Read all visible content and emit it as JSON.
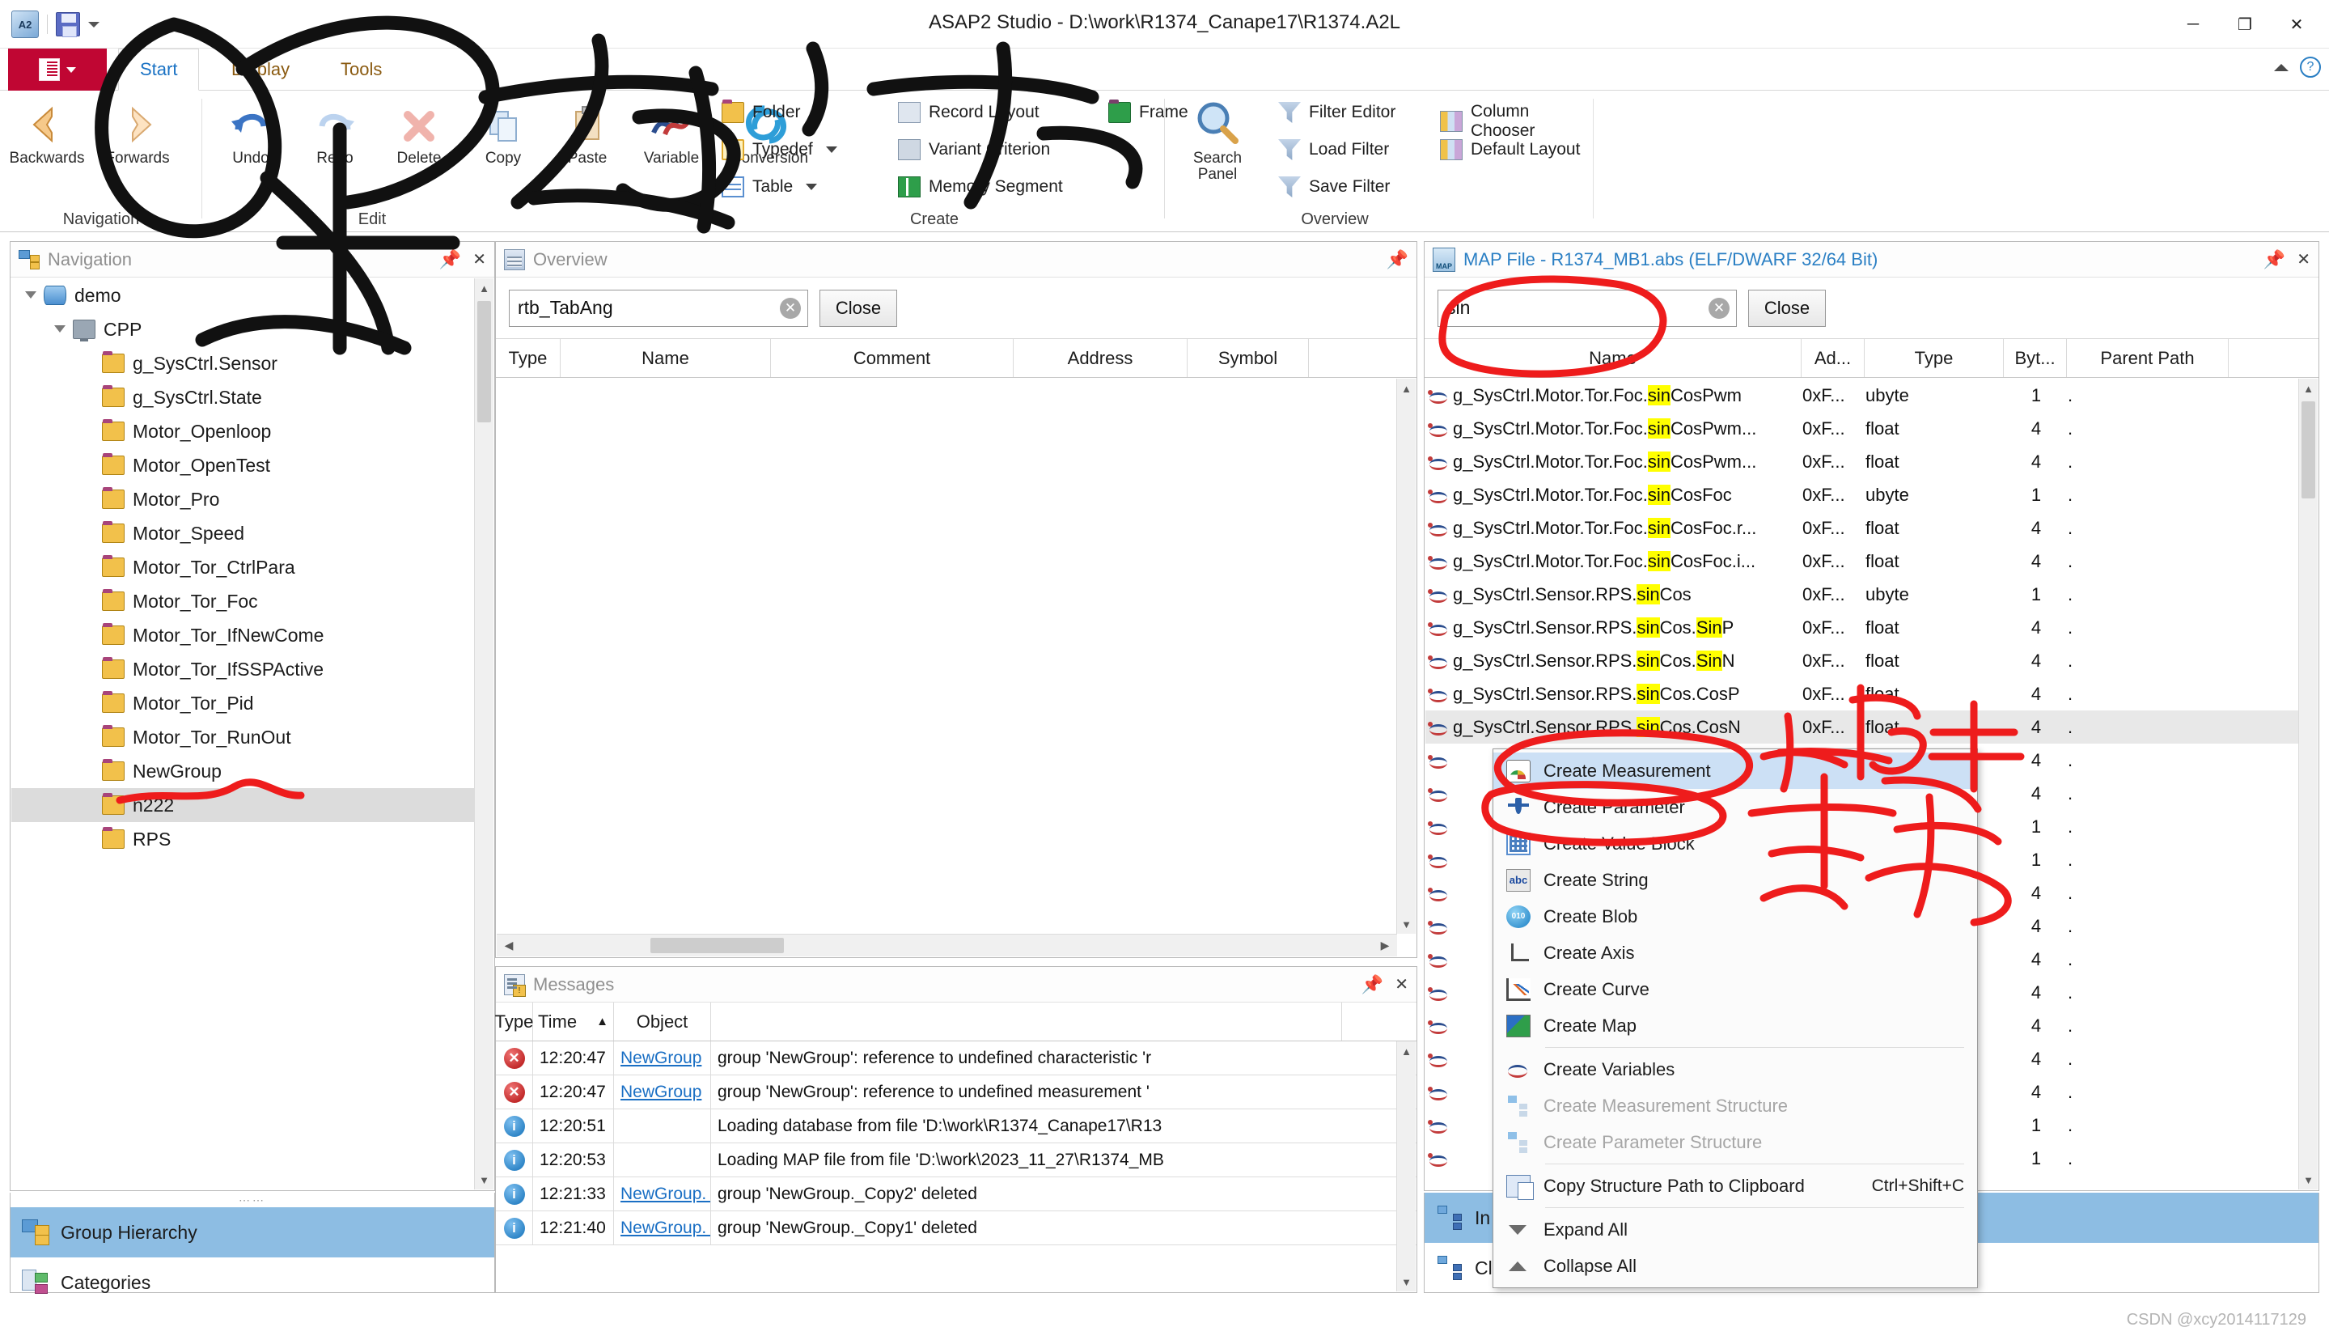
{
  "window": {
    "title": "ASAP2 Studio - D:\\work\\R1374_Canape17\\R1374.A2L",
    "minimize": "─",
    "maximize": "❐",
    "close": "✕"
  },
  "quick_access": {
    "app_icon": "asap2-icon",
    "save_icon": "save-icon",
    "more_icon": "chevron-down-icon"
  },
  "ribbon": {
    "file_label": "",
    "tabs": [
      {
        "label": "Start",
        "active": true
      },
      {
        "label": "Display",
        "active": false
      },
      {
        "label": "Tools",
        "active": false
      }
    ],
    "collapse_icon": "chevron-up-icon",
    "help_icon": "help-icon",
    "groups": [
      {
        "name": "Navigation",
        "buttons": [
          {
            "label": "Backwards",
            "icon": "arrow-left-icon"
          },
          {
            "label": "Forwards",
            "icon": "arrow-right-icon"
          }
        ]
      },
      {
        "name": "Edit",
        "buttons": [
          {
            "label": "Undo",
            "icon": "undo-icon"
          },
          {
            "label": "Redo",
            "icon": "redo-icon"
          },
          {
            "label": "Delete",
            "icon": "delete-icon"
          },
          {
            "label": "Copy",
            "icon": "copy-icon"
          },
          {
            "label": "Paste",
            "icon": "paste-icon"
          },
          {
            "label": "Variable",
            "icon": "variable-icon"
          },
          {
            "label": "Conversion",
            "icon": "conversion-icon"
          }
        ]
      },
      {
        "name": "Create",
        "items": [
          {
            "label": "Folder",
            "icon": "folder-icon",
            "dropdown": true
          },
          {
            "label": "Record Layout",
            "icon": "record-layout-icon",
            "dropdown": false
          },
          {
            "label": "Frame",
            "icon": "frame-icon",
            "dropdown": false
          },
          {
            "label": "Typedef",
            "icon": "typedef-icon",
            "dropdown": true
          },
          {
            "label": "Variant Criterion",
            "icon": "variant-criterion-icon",
            "dropdown": false
          },
          {
            "label": "Table",
            "icon": "table-icon",
            "dropdown": true
          },
          {
            "label": "Memory Segment",
            "icon": "memory-segment-icon",
            "dropdown": false
          }
        ]
      },
      {
        "name": "Overview",
        "big": {
          "label_line1": "Search",
          "label_line2": "Panel",
          "icon": "search-icon"
        },
        "items": [
          {
            "label": "Filter Editor",
            "icon": "filter-editor-icon"
          },
          {
            "label": "Column Chooser",
            "icon": "column-chooser-icon"
          },
          {
            "label": "Load Filter",
            "icon": "load-filter-icon"
          },
          {
            "label": "Default Layout",
            "icon": "default-layout-icon"
          },
          {
            "label": "Save Filter",
            "icon": "save-filter-icon"
          }
        ]
      }
    ]
  },
  "navigation": {
    "title": "Navigation",
    "icon": "navigation-icon",
    "pin_icon": "pin-icon",
    "close_icon": "close-icon",
    "tree": [
      {
        "label": "demo",
        "depth": 0,
        "icon": "database-icon",
        "expander": "open",
        "selected": false
      },
      {
        "label": "CPP",
        "depth": 1,
        "icon": "computer-icon",
        "expander": "open",
        "selected": false
      },
      {
        "label": "g_SysCtrl.Sensor",
        "depth": 2,
        "icon": "folder-icon",
        "expander": "none",
        "selected": false
      },
      {
        "label": "g_SysCtrl.State",
        "depth": 2,
        "icon": "folder-icon",
        "expander": "none",
        "selected": false
      },
      {
        "label": "Motor_Openloop",
        "depth": 2,
        "icon": "folder-icon",
        "expander": "none",
        "selected": false
      },
      {
        "label": "Motor_OpenTest",
        "depth": 2,
        "icon": "folder-icon",
        "expander": "none",
        "selected": false
      },
      {
        "label": "Motor_Pro",
        "depth": 2,
        "icon": "folder-icon",
        "expander": "none",
        "selected": false
      },
      {
        "label": "Motor_Speed",
        "depth": 2,
        "icon": "folder-icon",
        "expander": "none",
        "selected": false
      },
      {
        "label": "Motor_Tor_CtrlPara",
        "depth": 2,
        "icon": "folder-icon",
        "expander": "none",
        "selected": false
      },
      {
        "label": "Motor_Tor_Foc",
        "depth": 2,
        "icon": "folder-icon",
        "expander": "none",
        "selected": false
      },
      {
        "label": "Motor_Tor_IfNewCome",
        "depth": 2,
        "icon": "folder-icon",
        "expander": "none",
        "selected": false
      },
      {
        "label": "Motor_Tor_IfSSPActive",
        "depth": 2,
        "icon": "folder-icon",
        "expander": "none",
        "selected": false
      },
      {
        "label": "Motor_Tor_Pid",
        "depth": 2,
        "icon": "folder-icon",
        "expander": "none",
        "selected": false
      },
      {
        "label": "Motor_Tor_RunOut",
        "depth": 2,
        "icon": "folder-icon",
        "expander": "none",
        "selected": false
      },
      {
        "label": "NewGroup",
        "depth": 2,
        "icon": "folder-icon",
        "expander": "none",
        "selected": false
      },
      {
        "label": "n222",
        "depth": 2,
        "icon": "folder-icon",
        "expander": "none",
        "selected": true
      },
      {
        "label": "RPS",
        "depth": 2,
        "icon": "folder-icon",
        "expander": "none",
        "selected": false
      }
    ],
    "footer_items": [
      {
        "label": "Group Hierarchy",
        "icon": "group-hierarchy-icon",
        "selected": true
      },
      {
        "label": "Categories",
        "icon": "categories-icon",
        "selected": false
      }
    ]
  },
  "overview": {
    "title": "Overview",
    "icon": "overview-icon",
    "pin_icon": "pin-icon",
    "search": {
      "value": "rtb_TabAng",
      "placeholder": "",
      "clear_icon": "clear-icon"
    },
    "close_button": "Close",
    "columns": [
      "Type",
      "Name",
      "Comment",
      "Address",
      "Symbol"
    ],
    "rows": []
  },
  "messages": {
    "title": "Messages",
    "icon": "messages-icon",
    "pin_icon": "pin-icon",
    "close_icon": "close-icon",
    "columns": [
      "Type",
      "Time",
      "Object",
      ""
    ],
    "sort_indicator": "▲",
    "rows": [
      {
        "type": "error",
        "time": "12:20:47",
        "object": "NewGroup",
        "text": "group 'NewGroup': reference to undefined characteristic 'r"
      },
      {
        "type": "error",
        "time": "12:20:47",
        "object": "NewGroup",
        "text": "group 'NewGroup': reference to undefined measurement '"
      },
      {
        "type": "info",
        "time": "12:20:51",
        "object": "",
        "text": "Loading database from file 'D:\\work\\R1374_Canape17\\R13"
      },
      {
        "type": "info",
        "time": "12:20:53",
        "object": "",
        "text": "Loading MAP file from file 'D:\\work\\2023_11_27\\R1374_MB"
      },
      {
        "type": "info",
        "time": "12:21:33",
        "object": "NewGroup._Copy",
        "text": "group 'NewGroup._Copy2' deleted"
      },
      {
        "type": "info",
        "time": "12:21:40",
        "object": "NewGroup._Copy",
        "text": "group 'NewGroup._Copy1' deleted"
      }
    ]
  },
  "map_file": {
    "title": "MAP File - R1374_MB1.abs (ELF/DWARF 32/64 Bit)",
    "icon": "map-file-icon",
    "pin_icon": "pin-icon",
    "close_icon": "close-icon",
    "search": {
      "value": "sin",
      "placeholder": "",
      "clear_icon": "clear-icon"
    },
    "close_button": "Close",
    "columns": [
      "Name",
      "Ad...",
      "Type",
      "Byt...",
      "Parent Path"
    ],
    "highlight_term": "sin",
    "rows": [
      {
        "name": "g_SysCtrl.Motor.Tor.Foc.sinCosPwm",
        "address": "0xF...",
        "type": "ubyte",
        "bytes": "1",
        "parent": "."
      },
      {
        "name": "g_SysCtrl.Motor.Tor.Foc.sinCosPwm...",
        "address": "0xF...",
        "type": "float",
        "bytes": "4",
        "parent": "."
      },
      {
        "name": "g_SysCtrl.Motor.Tor.Foc.sinCosPwm...",
        "address": "0xF...",
        "type": "float",
        "bytes": "4",
        "parent": "."
      },
      {
        "name": "g_SysCtrl.Motor.Tor.Foc.sinCosFoc",
        "address": "0xF...",
        "type": "ubyte",
        "bytes": "1",
        "parent": "."
      },
      {
        "name": "g_SysCtrl.Motor.Tor.Foc.sinCosFoc.r...",
        "address": "0xF...",
        "type": "float",
        "bytes": "4",
        "parent": "."
      },
      {
        "name": "g_SysCtrl.Motor.Tor.Foc.sinCosFoc.i...",
        "address": "0xF...",
        "type": "float",
        "bytes": "4",
        "parent": "."
      },
      {
        "name": "g_SysCtrl.Sensor.RPS.sinCos",
        "address": "0xF...",
        "type": "ubyte",
        "bytes": "1",
        "parent": "."
      },
      {
        "name": "g_SysCtrl.Sensor.RPS.sinCos.SinP",
        "address": "0xF...",
        "type": "float",
        "bytes": "4",
        "parent": "."
      },
      {
        "name": "g_SysCtrl.Sensor.RPS.sinCos.SinN",
        "address": "0xF...",
        "type": "float",
        "bytes": "4",
        "parent": "."
      },
      {
        "name": "g_SysCtrl.Sensor.RPS.sinCos.CosP",
        "address": "0xF...",
        "type": "float",
        "bytes": "4",
        "parent": "."
      },
      {
        "name": "g_SysCtrl.Sensor.RPS.sinCos.CosN",
        "address": "0xF...",
        "type": "float",
        "bytes": "4",
        "parent": ".",
        "selected": true
      },
      {
        "name": "",
        "address": "",
        "type": "",
        "bytes": "4",
        "parent": "."
      },
      {
        "name": "",
        "address": "",
        "type": "",
        "bytes": "4",
        "parent": "."
      },
      {
        "name": "",
        "address": "",
        "type": "",
        "bytes": "1",
        "parent": "."
      },
      {
        "name": "",
        "address": "",
        "type": "",
        "bytes": "1",
        "parent": "."
      },
      {
        "name": "",
        "address": "",
        "type": "",
        "bytes": "4",
        "parent": "."
      },
      {
        "name": "",
        "address": "",
        "type": "",
        "bytes": "4",
        "parent": "."
      },
      {
        "name": "",
        "address": "",
        "type": "",
        "bytes": "4",
        "parent": "."
      },
      {
        "name": "",
        "address": "",
        "type": "",
        "bytes": "4",
        "parent": "."
      },
      {
        "name": "",
        "address": "",
        "type": "",
        "bytes": "4",
        "parent": "."
      },
      {
        "name": "",
        "address": "",
        "type": "",
        "bytes": "4",
        "parent": "."
      },
      {
        "name": "",
        "address": "",
        "type": "",
        "bytes": "4",
        "parent": "."
      },
      {
        "name": "",
        "address": "",
        "type": "",
        "bytes": "1",
        "parent": "."
      },
      {
        "name": "",
        "address": "",
        "type": "",
        "bytes": "1",
        "parent": "."
      }
    ],
    "footer_items": [
      {
        "label": "In",
        "icon": "tree-icon",
        "selected": true
      },
      {
        "label": "Classes & Type Definitions",
        "icon": "tree-icon",
        "selected": false
      }
    ]
  },
  "context_menu": {
    "items": [
      {
        "label": "Create Measurement",
        "icon": "measurement-icon",
        "highlighted": true,
        "disabled": false
      },
      {
        "label": "Create Parameter",
        "icon": "parameter-icon",
        "highlighted": false,
        "disabled": false
      },
      {
        "label": "Create Value Block",
        "icon": "value-block-icon",
        "highlighted": false,
        "disabled": false
      },
      {
        "label": "Create String",
        "icon": "string-icon",
        "highlighted": false,
        "disabled": false
      },
      {
        "label": "Create Blob",
        "icon": "blob-icon",
        "highlighted": false,
        "disabled": false
      },
      {
        "label": "Create Axis",
        "icon": "axis-icon",
        "highlighted": false,
        "disabled": false
      },
      {
        "label": "Create Curve",
        "icon": "curve-icon",
        "highlighted": false,
        "disabled": false
      },
      {
        "label": "Create Map",
        "icon": "map-icon",
        "highlighted": false,
        "disabled": false,
        "separator_after": true
      },
      {
        "label": "Create Variables",
        "icon": "variables-icon",
        "highlighted": false,
        "disabled": false
      },
      {
        "label": "Create Measurement Structure",
        "icon": "structure-icon",
        "highlighted": false,
        "disabled": true
      },
      {
        "label": "Create Parameter Structure",
        "icon": "structure-icon",
        "highlighted": false,
        "disabled": true,
        "separator_after": true
      },
      {
        "label": "Copy Structure Path to Clipboard",
        "icon": "copy-icon",
        "highlighted": false,
        "disabled": false,
        "shortcut": "Ctrl+Shift+C",
        "separator_after": true
      },
      {
        "label": "Expand All",
        "icon": "expand-all-icon",
        "highlighted": false,
        "disabled": false
      },
      {
        "label": "Collapse All",
        "icon": "collapse-all-icon",
        "highlighted": false,
        "disabled": false
      }
    ]
  },
  "watermark": "CSDN @xcy2014117129",
  "annotations": {
    "ink_color_red": "#ee1c1c",
    "ink_color_black": "#111111",
    "handwritten_cn_1": "保存",
    "handwritten_cn_2": "加上",
    "handwritten_cn_3": "标志"
  }
}
